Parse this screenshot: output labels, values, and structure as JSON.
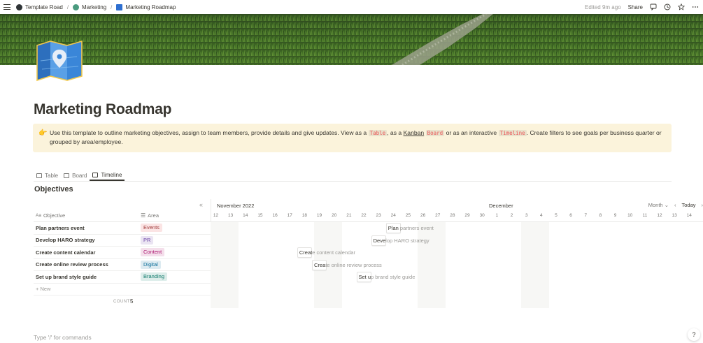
{
  "breadcrumb": {
    "items": [
      "Template Road",
      "Marketing",
      "Marketing Roadmap"
    ]
  },
  "topbar": {
    "edited": "Edited 9m ago",
    "share": "Share"
  },
  "page": {
    "title": "Marketing Roadmap"
  },
  "callout": {
    "emoji": "👉",
    "text1": "Use this template to outline marketing objectives, assign to team members, provide details and give updates. View as a",
    "code1": "Table",
    "text2": ", as a",
    "kanban": "Kanban",
    "code2": "Board",
    "text3": "or as an interactive",
    "code3": "Timeline",
    "text4": ". Create filters to see goals per business quarter or",
    "text5": "grouped by area/employee."
  },
  "tabs": [
    {
      "label": "Table"
    },
    {
      "label": "Board"
    },
    {
      "label": "Timeline"
    }
  ],
  "database": {
    "title": "Objectives",
    "col_objective": "Objective",
    "col_area": "Area",
    "new": "+ New",
    "count_label": "COUNT",
    "count": "5",
    "rows": [
      {
        "objective": "Plan partners event",
        "area": "Events",
        "area_bg": "#fbe4e4",
        "area_fg": "#a13c3c"
      },
      {
        "objective": "Develop HARO strategy",
        "area": "PR",
        "area_bg": "#eae4f2",
        "area_fg": "#6940a5"
      },
      {
        "objective": "Create content calendar",
        "area": "Content",
        "area_bg": "#f4dfeb",
        "area_fg": "#ad1a72"
      },
      {
        "objective": "Create online review process",
        "area": "Digital",
        "area_bg": "#ddebf1",
        "area_fg": "#0b6e99"
      },
      {
        "objective": "Set up brand style guide",
        "area": "Branding",
        "area_bg": "#ddedea",
        "area_fg": "#0f7b6c"
      }
    ]
  },
  "timeline": {
    "month1": "November 2022",
    "month2": "December",
    "view": "Month",
    "today": "Today",
    "days": [
      "12",
      "13",
      "14",
      "15",
      "16",
      "17",
      "18",
      "19",
      "20",
      "21",
      "22",
      "23",
      "24",
      "25",
      "26",
      "27",
      "28",
      "29",
      "30",
      "1",
      "2",
      "3",
      "4",
      "5",
      "6",
      "7",
      "8",
      "9",
      "10",
      "11",
      "12",
      "13",
      "14"
    ],
    "bars": [
      {
        "start": "Plan",
        "rest": " partners event"
      },
      {
        "start": "Deve",
        "rest": "lop HARO strategy"
      },
      {
        "start": "Creat",
        "rest": "e content calendar"
      },
      {
        "start": "Crea",
        "rest": "te online review process"
      },
      {
        "start": "Set u",
        "rest": "p brand style guide"
      }
    ]
  },
  "footer": {
    "hint": "Type '/' for commands",
    "help": "?"
  }
}
